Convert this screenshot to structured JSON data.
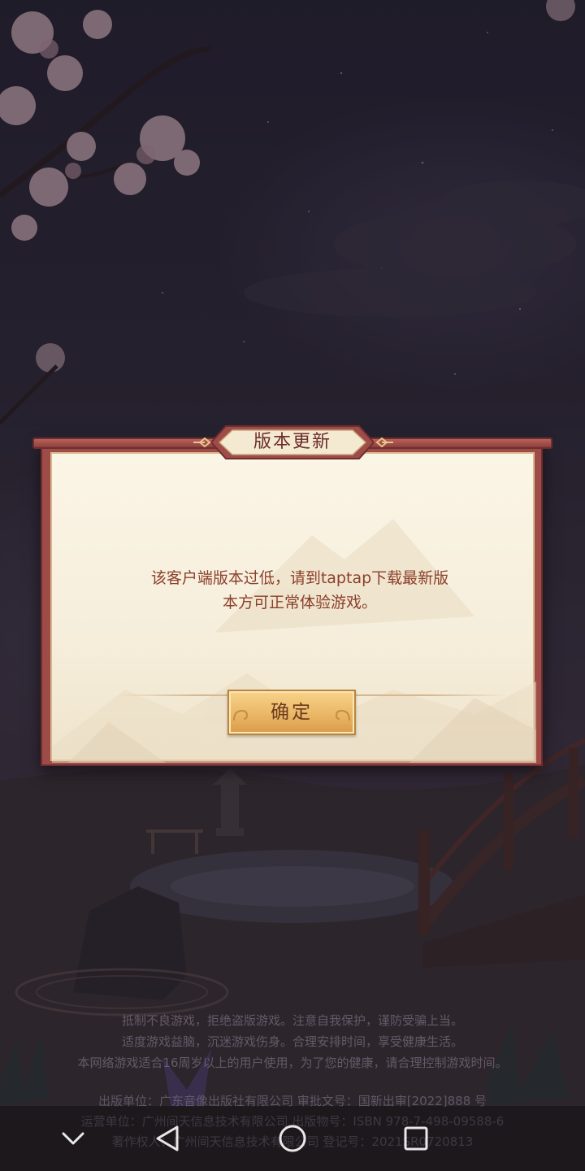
{
  "dialog": {
    "title": "版本更新",
    "message_line1": "该客户端版本过低，请到taptap下载最新版",
    "message_line2": "本方可正常体验游戏。",
    "confirm_label": "确定"
  },
  "notice": {
    "line1": "抵制不良游戏，拒绝盗版游戏。注意自我保护，谨防受骗上当。",
    "line2": "适度游戏益脑，沉迷游戏伤身。合理安排时间，享受健康生活。",
    "line3": "本网络游戏适合16周岁以上的用户使用，为了您的健康，请合理控制游戏时间。"
  },
  "publisher": {
    "line1": "出版单位：广东音像出版社有限公司  审批文号：国新出审[2022]888 号",
    "line2": "运营单位：广州间天信息技术有限公司  出版物号：ISBN 978-7-498-09588-6",
    "line3": "著作权人：广州间天信息技术有限公司  登记号：2021SR0720813"
  },
  "navbar": {
    "icons": [
      "chevron-down-icon",
      "back-triangle-icon",
      "home-circle-icon",
      "recents-square-icon"
    ]
  },
  "colors": {
    "frame": "#9e4c48",
    "paper": "#f6eedb",
    "title_text": "#6b2c2a",
    "message_text": "#8b3f2a",
    "button_gold": "#eab766"
  }
}
